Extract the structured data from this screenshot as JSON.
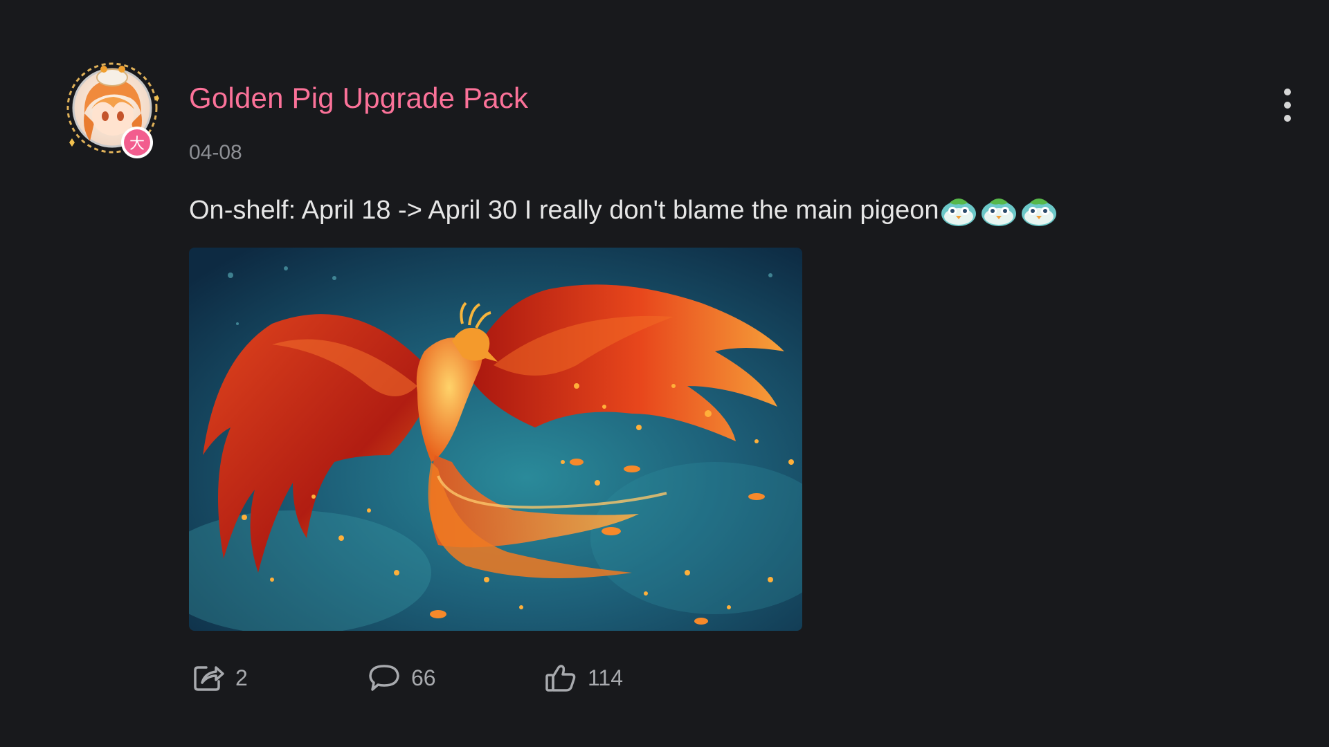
{
  "post": {
    "author": "Golden Pig Upgrade Pack",
    "date": "04-08",
    "text": "On-shelf: April 18 -> April 30 I really don't blame the main pigeon",
    "emotes": [
      "pigeon-emote",
      "pigeon-emote",
      "pigeon-emote"
    ],
    "avatar_badge": "大",
    "image_subject": "phoenix"
  },
  "actions": {
    "share_count": "2",
    "comment_count": "66",
    "like_count": "114"
  },
  "colors": {
    "background": "#18191c",
    "author": "#fb7299",
    "text": "#e6e6e6",
    "muted": "#8d8f94",
    "badge": "#f25d8e"
  },
  "icons": [
    "share-icon",
    "comment-icon",
    "like-icon",
    "more-icon"
  ]
}
